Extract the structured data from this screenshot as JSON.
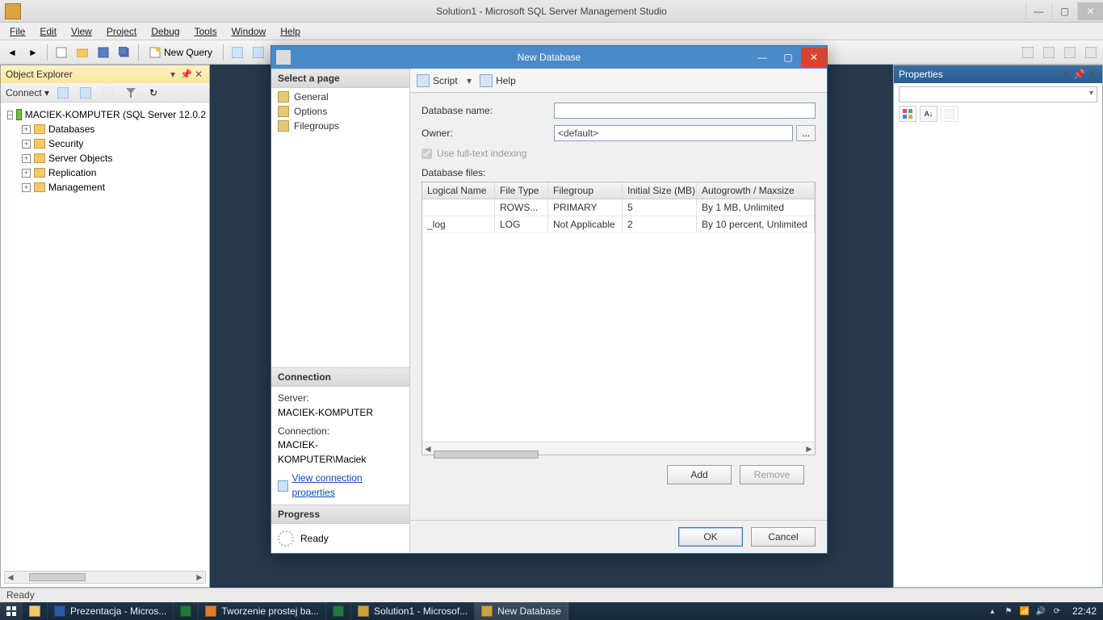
{
  "app": {
    "title": "Solution1 - Microsoft SQL Server Management Studio",
    "menubar": [
      "File",
      "Edit",
      "View",
      "Project",
      "Debug",
      "Tools",
      "Window",
      "Help"
    ],
    "new_query_label": "New Query",
    "status": "Ready"
  },
  "object_explorer": {
    "title": "Object Explorer",
    "connect_label": "Connect",
    "root": "MACIEK-KOMPUTER (SQL Server 12.0.2",
    "children": [
      "Databases",
      "Security",
      "Server Objects",
      "Replication",
      "Management"
    ]
  },
  "properties": {
    "title": "Properties"
  },
  "dialog": {
    "title": "New Database",
    "select_page_hdr": "Select a page",
    "pages": [
      "General",
      "Options",
      "Filegroups"
    ],
    "connection_hdr": "Connection",
    "server_lbl": "Server:",
    "server_val": "MACIEK-KOMPUTER",
    "conn_lbl": "Connection:",
    "conn_val": "MACIEK-KOMPUTER\\Maciek",
    "view_conn_link": "View connection properties",
    "progress_hdr": "Progress",
    "progress_val": "Ready",
    "toolbar": {
      "script": "Script",
      "help": "Help"
    },
    "form": {
      "db_name_lbl": "Database name:",
      "db_name_val": "",
      "owner_lbl": "Owner:",
      "owner_val": "<default>",
      "fulltext_lbl": "Use full-text indexing",
      "files_lbl": "Database files:"
    },
    "grid": {
      "headers": [
        "Logical Name",
        "File Type",
        "Filegroup",
        "Initial Size (MB)",
        "Autogrowth / Maxsize"
      ],
      "rows": [
        {
          "logical": "",
          "type": "ROWS...",
          "filegroup": "PRIMARY",
          "size": "5",
          "growth": "By 1 MB, Unlimited"
        },
        {
          "logical": "_log",
          "type": "LOG",
          "filegroup": "Not Applicable",
          "size": "2",
          "growth": "By 10 percent, Unlimited"
        }
      ]
    },
    "buttons": {
      "add": "Add",
      "remove": "Remove",
      "ok": "OK",
      "cancel": "Cancel"
    }
  },
  "taskbar": {
    "items": [
      {
        "label": "Prezentacja - Micros...",
        "color": "#2a5aa8"
      },
      {
        "label": "",
        "color": "#1f7a3a"
      },
      {
        "label": "Tworzenie prostej ba...",
        "color": "#e27b2a"
      },
      {
        "label": "",
        "color": "#1f7a3a"
      },
      {
        "label": "Solution1 - Microsof...",
        "color": "#caa23a"
      },
      {
        "label": "New Database",
        "color": "#caa23a",
        "active": true
      }
    ],
    "clock": "22:42"
  }
}
